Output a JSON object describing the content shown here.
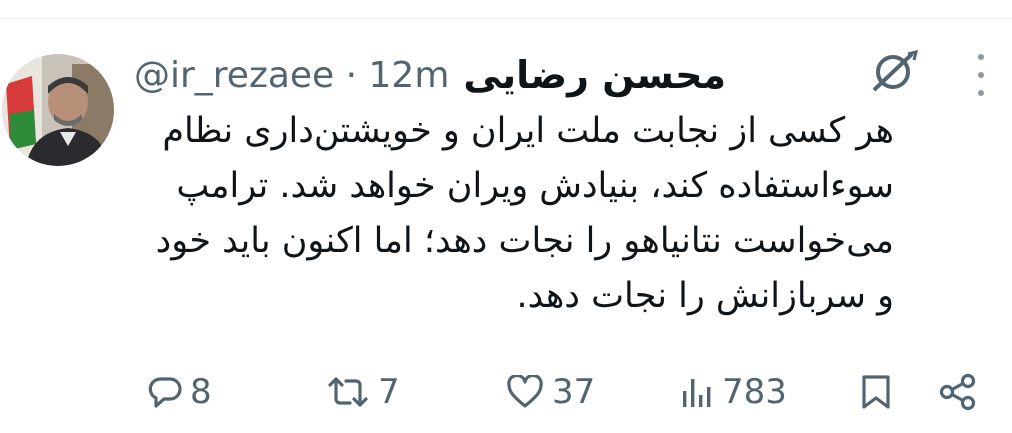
{
  "tweet": {
    "display_name": "محسن رضایی",
    "handle_line": "@ir_rezaee · 12m",
    "body_lines": [
      "هر کسی از نجابت ملت ایران و خویشتن‌داری نظام",
      "سوءاستفاده کند، بنیادش ویران خواهد شد. ترامپ",
      "می‌خواست نتانیاهو را نجات دهد؛ اما اکنون باید خود",
      "و سربازانش را نجات دهد."
    ]
  },
  "actions": {
    "replies": "8",
    "reposts": "7",
    "likes": "37",
    "views": "783"
  },
  "colors": {
    "text": "#0f1419",
    "secondary": "#536471",
    "divider": "#eff3f4"
  },
  "icons": [
    "grok-icon",
    "more-icon",
    "reply-icon",
    "repost-icon",
    "like-icon",
    "views-icon",
    "bookmark-icon",
    "share-icon"
  ]
}
